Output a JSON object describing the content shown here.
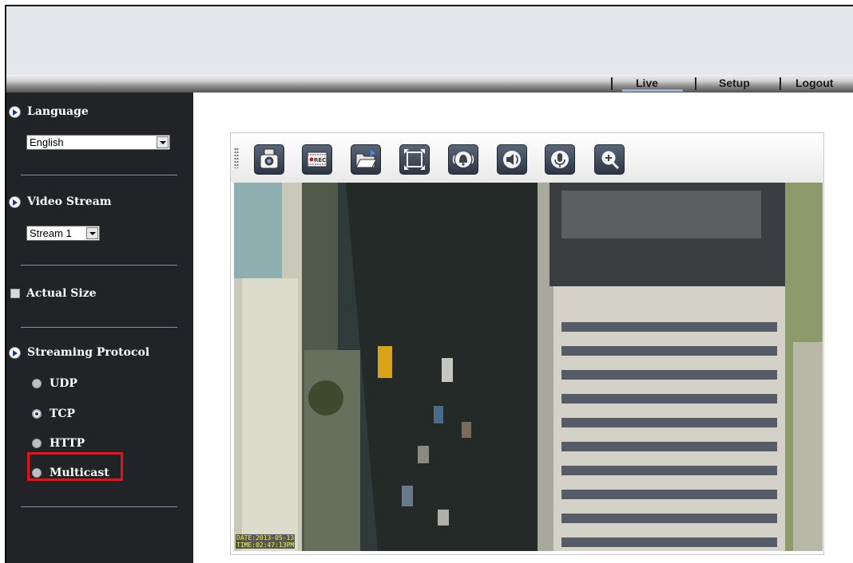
{
  "nav": {
    "live": "Live",
    "setup": "Setup",
    "logout": "Logout"
  },
  "sidebar": {
    "language": {
      "label": "Language",
      "value": "English"
    },
    "video_stream": {
      "label": "Video Stream",
      "value": "Stream 1"
    },
    "actual_size": {
      "label": "Actual Size",
      "checked": false
    },
    "streaming_protocol": {
      "label": "Streaming Protocol",
      "options": [
        "UDP",
        "TCP",
        "HTTP",
        "Multicast"
      ],
      "selected": "TCP",
      "highlighted": "Multicast"
    }
  },
  "toolbar": {
    "buttons": [
      "camera-snapshot-icon",
      "record-icon",
      "folder-open-icon",
      "fullscreen-icon",
      "alarm-bell-icon",
      "speaker-icon",
      "microphone-icon",
      "zoom-in-icon"
    ],
    "record_badge": "REC"
  },
  "video": {
    "osd_date": "DATE:2013-05-13",
    "osd_time": "TIME:02:47:13PM"
  },
  "colors": {
    "sidebar_bg": "#222327",
    "highlight": "#e0141c",
    "header_bg": "#e4e7ec"
  }
}
